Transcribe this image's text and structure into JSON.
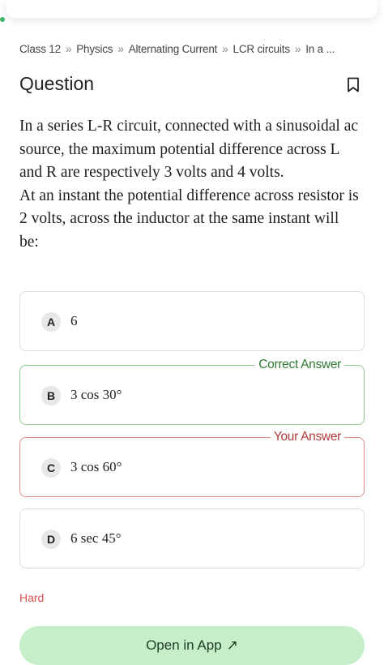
{
  "breadcrumb": {
    "items": [
      "Class 12",
      "Physics",
      "Alternating Current",
      "LCR circuits",
      "In a ..."
    ],
    "separator": "»"
  },
  "question": {
    "title": "Question",
    "paragraphs": [
      "In a series L-R circuit, connected with a sinusoidal ac source, the maximum potential difference across L and R are respectively 3 volts and 4 volts.",
      "At an instant the potential difference across resistor is 2 volts, across the inductor at the same instant will be:"
    ]
  },
  "options": [
    {
      "letter": "A",
      "text": "6",
      "status": ""
    },
    {
      "letter": "B",
      "text": "3 cos 30°",
      "status": "correct",
      "tag": "Correct Answer"
    },
    {
      "letter": "C",
      "text": "3 cos 60°",
      "status": "yours",
      "tag": "Your Answer"
    },
    {
      "letter": "D",
      "text": "6 sec 45°",
      "status": ""
    }
  ],
  "difficulty": "Hard",
  "open_app": {
    "label": "Open in App",
    "arrow": "↗"
  },
  "icons": {
    "bookmark": "bookmark-icon"
  },
  "colors": {
    "correct": "#2e7d32",
    "wrong": "#b23a3a",
    "cta_bg": "#c5eec9",
    "difficulty": "#d9534f"
  }
}
